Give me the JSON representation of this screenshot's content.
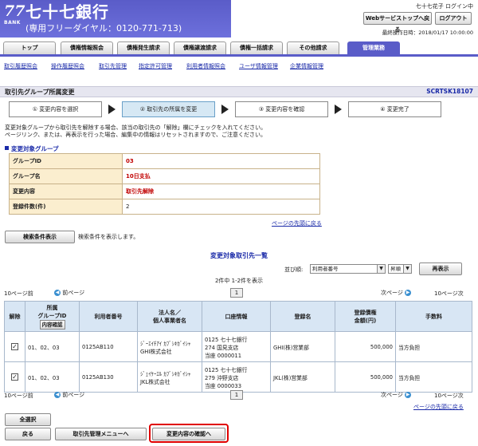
{
  "header": {
    "logo_number": "77",
    "logo_bank": "BANK",
    "bank_name": "七十七銀行",
    "freedial": "(専用フリーダイヤル：0120-771-713)",
    "user_status": "七十七花子 ログイン中",
    "web_top_label": "Webサービストップへ戻る",
    "logout_label": "ログアウト",
    "last_operation": "最終操作日時：2018/01/17 10:00:00"
  },
  "tabs": [
    {
      "label": "トップ"
    },
    {
      "label": "債権情報照会"
    },
    {
      "label": "債権発生請求"
    },
    {
      "label": "債権譲渡請求"
    },
    {
      "label": "債権一括請求"
    },
    {
      "label": "その他請求"
    },
    {
      "label": "管理業務"
    }
  ],
  "subnav": [
    {
      "label": "取引履歴照会"
    },
    {
      "label": "操作履歴照会"
    },
    {
      "label": "取引先管理"
    },
    {
      "label": "指定許可管理"
    },
    {
      "label": "利用者情報照会"
    },
    {
      "label": "ユーザ情報管理"
    },
    {
      "label": "企業情報管理"
    }
  ],
  "page": {
    "title": "取引先グループ所属変更",
    "screen_id": "SCRTSK18107"
  },
  "steps": [
    {
      "label": "① 変更内容を選択"
    },
    {
      "label": "② 取引先の所属を変更"
    },
    {
      "label": "③ 変更内容を確認"
    },
    {
      "label": "④ 変更完了"
    }
  ],
  "notes": {
    "line1": "変更対象グループから取引先を解除する場合、該当の取引先の「解除」欄にチェックを入れてください。",
    "line2": "ページリンク、または、再表示を行った場合、編集中の情報はリセットされますので、ご注意ください。"
  },
  "section": {
    "title": "変更対象グループ"
  },
  "info": {
    "rows": [
      {
        "label": "グループID",
        "value": "03"
      },
      {
        "label": "グループ名",
        "value": "10日支払"
      },
      {
        "label": "変更内容",
        "value": "取引先解除"
      },
      {
        "label": "登録件数(件)",
        "value": "2"
      }
    ]
  },
  "page_top_label": "ページの先頭に戻る",
  "search": {
    "button_label": "検索条件表示",
    "note": "検索条件を表示します。"
  },
  "list": {
    "title": "変更対象取引先一覧",
    "sort_label": "並び順:",
    "sort_value": "利用者番号",
    "order_value": "昇順",
    "redisplay_label": "再表示",
    "count_text": "2件中 1-2件を表示",
    "prev10": "10ページ前",
    "prev": "前ページ",
    "next": "次ページ",
    "next10": "10ページ次",
    "current_page": "1",
    "headers": {
      "release": "解除",
      "group_id_line1": "所属",
      "group_id_line2": "グループID",
      "group_confirm_btn": "内容確認",
      "user_number": "利用者番号",
      "corp_line1": "法人名／",
      "corp_line2": "個人事業者名",
      "account": "口座情報",
      "registered": "登録名",
      "limit_line1": "登録債権",
      "limit_line2": "金額(円)",
      "fee": "手数料"
    },
    "rows": [
      {
        "group_ids": "01、02、03",
        "user_number": "0125AB110",
        "corp_kana": "ｼﾞｰｴｲﾁｱｲ ｶﾌﾞｼｷｶﾞｲｼｬ",
        "corp_name": "GHI株式会社",
        "acct_line1": "0125 七十七銀行",
        "acct_line2": "274 国見支店",
        "acct_line3": "当座 0000011",
        "registered": "GHI(株)営業部",
        "amount": "500,000",
        "fee": "当方負担"
      },
      {
        "group_ids": "01、02、03",
        "user_number": "0125AB130",
        "corp_kana": "ｼﾞｪｲｹｰｴﾙ ｶﾌﾞｼｷｶﾞｲｼｬ",
        "corp_name": "JKL株式会社",
        "acct_line1": "0125 七十七銀行",
        "acct_line2": "279 沖野支店",
        "acct_line3": "当座 0000033",
        "registered": "JKL(株)営業部",
        "amount": "500,000",
        "fee": "当方負担"
      }
    ]
  },
  "footer": {
    "select_all": "全選択",
    "back": "戻る",
    "partner_menu": "取引先管理メニューへ",
    "confirm": "変更内容の確認へ"
  },
  "colors": {
    "accent": "#5a5cc8",
    "link": "#1a2aa8",
    "highlight": "#e00000"
  }
}
